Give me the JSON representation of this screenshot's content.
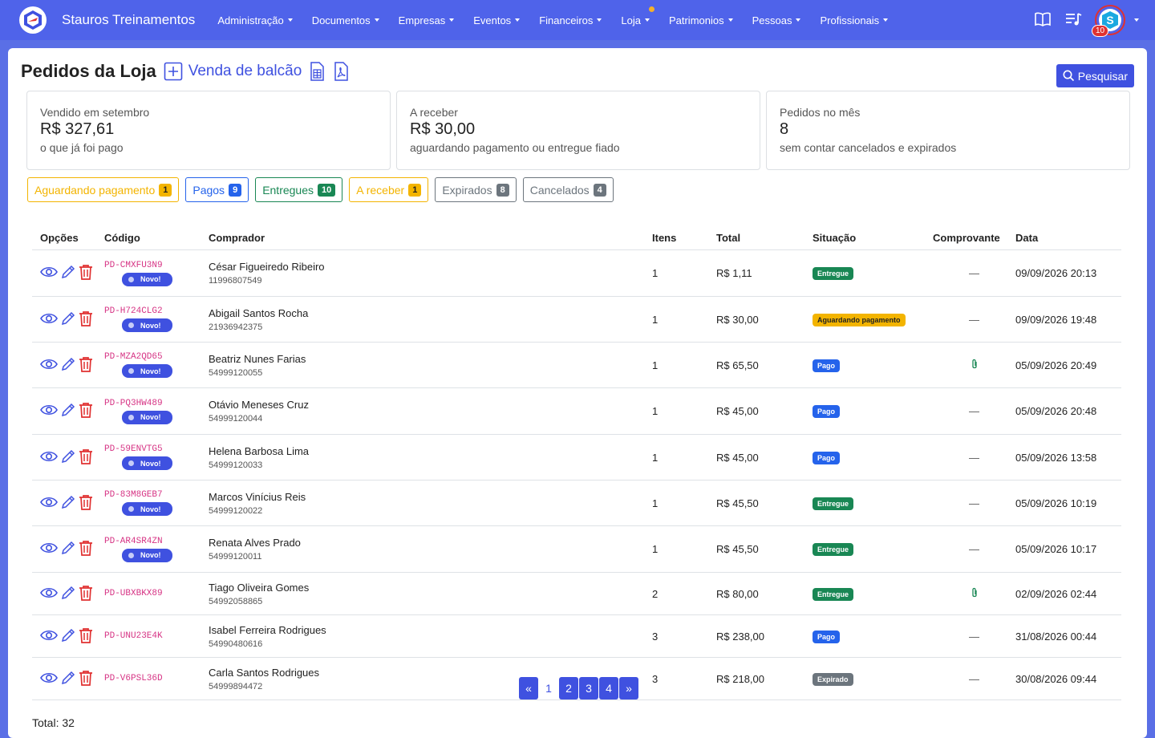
{
  "brand": {
    "name": "Stauros Treinamentos"
  },
  "menu": [
    {
      "label": "Administração"
    },
    {
      "label": "Documentos"
    },
    {
      "label": "Empresas"
    },
    {
      "label": "Eventos"
    },
    {
      "label": "Financeiros"
    },
    {
      "label": "Loja"
    },
    {
      "label": "Patrimonios"
    },
    {
      "label": "Pessoas"
    },
    {
      "label": "Profissionais"
    }
  ],
  "user": {
    "notifications": "10"
  },
  "page": {
    "title": "Pedidos da Loja",
    "venda_label": "Venda de balcão",
    "search_label": "Pesquisar"
  },
  "cards": [
    {
      "label": "Vendido em setembro",
      "value": "R$ 327,61",
      "sub": "o que já foi pago"
    },
    {
      "label": "A receber",
      "value": "R$ 30,00",
      "sub": "aguardando pagamento ou entregue fiado"
    },
    {
      "label": "Pedidos no mês",
      "value": "8",
      "sub": "sem contar cancelados e expirados"
    }
  ],
  "filters": [
    {
      "label": "Aguardando pagamento",
      "count": "1",
      "color": "#f3b400"
    },
    {
      "label": "Pagos",
      "count": "9",
      "color": "#2563eb"
    },
    {
      "label": "Entregues",
      "count": "10",
      "color": "#198754"
    },
    {
      "label": "A receber",
      "count": "1",
      "color": "#f3b400"
    },
    {
      "label": "Expirados",
      "count": "8",
      "color": "#6c757d"
    },
    {
      "label": "Cancelados",
      "count": "4",
      "color": "#6c757d"
    }
  ],
  "table": {
    "headers": [
      "Opções",
      "Código",
      "Comprador",
      "Itens",
      "Total",
      "Situação",
      "Comprovante",
      "Data"
    ],
    "rows": [
      {
        "code": "PD-CMXFU3N9",
        "novo": "Novo!",
        "buyer": "César Figueiredo Ribeiro",
        "phone": "11996807549",
        "items": "1",
        "total": "R$ 1,11",
        "status": "Entregue",
        "status_color": "#198754",
        "proof": "—",
        "date": "09/09/2026 20:13"
      },
      {
        "code": "PD-H724CLG2",
        "novo": "Novo!",
        "buyer": "Abigail Santos Rocha",
        "phone": "21936942375",
        "items": "1",
        "total": "R$ 30,00",
        "status": "Aguardando pagamento",
        "status_color": "#f3b400",
        "proof": "—",
        "date": "09/09/2026 19:48"
      },
      {
        "code": "PD-MZA2QD65",
        "novo": "Novo!",
        "buyer": "Beatriz Nunes Farias",
        "phone": "54999120055",
        "items": "1",
        "total": "R$ 65,50",
        "status": "Pago",
        "status_color": "#2563eb",
        "proof": "clip",
        "date": "05/09/2026 20:49"
      },
      {
        "code": "PD-PQ3HW489",
        "novo": "Novo!",
        "buyer": "Otávio Meneses Cruz",
        "phone": "54999120044",
        "items": "1",
        "total": "R$ 45,00",
        "status": "Pago",
        "status_color": "#2563eb",
        "proof": "—",
        "date": "05/09/2026 20:48"
      },
      {
        "code": "PD-59ENVTG5",
        "novo": "Novo!",
        "buyer": "Helena Barbosa Lima",
        "phone": "54999120033",
        "items": "1",
        "total": "R$ 45,00",
        "status": "Pago",
        "status_color": "#2563eb",
        "proof": "—",
        "date": "05/09/2026 13:58"
      },
      {
        "code": "PD-83M8GEB7",
        "novo": "Novo!",
        "buyer": "Marcos Vinícius Reis",
        "phone": "54999120022",
        "items": "1",
        "total": "R$ 45,50",
        "status": "Entregue",
        "status_color": "#198754",
        "proof": "—",
        "date": "05/09/2026 10:19"
      },
      {
        "code": "PD-AR4SR4ZN",
        "novo": "Novo!",
        "buyer": "Renata Alves Prado",
        "phone": "54999120011",
        "items": "1",
        "total": "R$ 45,50",
        "status": "Entregue",
        "status_color": "#198754",
        "proof": "—",
        "date": "05/09/2026 10:17"
      },
      {
        "code": "PD-UBXBKX89",
        "novo": "",
        "buyer": "Tiago Oliveira Gomes",
        "phone": "54992058865",
        "items": "2",
        "total": "R$ 80,00",
        "status": "Entregue",
        "status_color": "#198754",
        "proof": "clip",
        "date": "02/09/2026 02:44"
      },
      {
        "code": "PD-UNU23E4K",
        "novo": "",
        "buyer": "Isabel Ferreira Rodrigues",
        "phone": "54990480616",
        "items": "3",
        "total": "R$ 238,00",
        "status": "Pago",
        "status_color": "#2563eb",
        "proof": "—",
        "date": "31/08/2026 00:44"
      },
      {
        "code": "PD-V6PSL36D",
        "novo": "",
        "buyer": "Carla Santos Rodrigues",
        "phone": "54999894472",
        "items": "3",
        "total": "R$ 218,00",
        "status": "Expirado",
        "status_color": "#6c757d",
        "proof": "—",
        "date": "30/08/2026 09:44"
      }
    ]
  },
  "pagination": {
    "prev": "«",
    "pages": [
      "1",
      "2",
      "3",
      "4"
    ],
    "next": "»",
    "current": "1"
  },
  "footer": {
    "total": "Total: 32"
  }
}
